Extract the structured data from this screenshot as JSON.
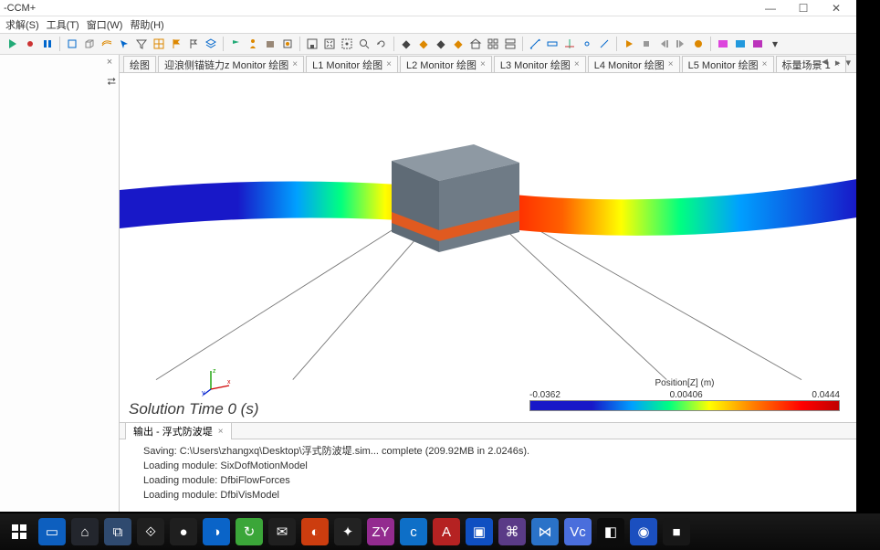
{
  "title_fragment": "-CCM+",
  "window_controls": {
    "min": "—",
    "max": "☐",
    "close": "✕"
  },
  "menu": {
    "solve": "求解(S)",
    "tools": "工具(T)",
    "window": "窗口(W)",
    "help": "帮助(H)"
  },
  "tabs": [
    {
      "label": "绘图"
    },
    {
      "label": "迎浪侧锚链力z Monitor 绘图"
    },
    {
      "label": "L1 Monitor 绘图"
    },
    {
      "label": "L2 Monitor 绘图"
    },
    {
      "label": "L3 Monitor 绘图"
    },
    {
      "label": "L4 Monitor 绘图"
    },
    {
      "label": "L5 Monitor 绘图"
    },
    {
      "label": "标量场景 1"
    }
  ],
  "tab_close_glyph": "×",
  "tab_nav": {
    "prev": "◄",
    "next": "▸",
    "menu": "▾"
  },
  "left_panel": {
    "close_glyph": "×",
    "tree_toggle": "⮂"
  },
  "scene": {
    "solution_time": "Solution Time 0 (s)",
    "triad": {
      "x": "x",
      "y": "y",
      "z": "z"
    },
    "legend": {
      "title": "Position[Z] (m)",
      "min": "-0.0362",
      "mid": "0.00406",
      "max": "0.0444"
    }
  },
  "output": {
    "tab_label": "输出 - 浮式防波堤",
    "lines": [
      "Saving: C:\\Users\\zhangxq\\Desktop\\浮式防波堤.sim... complete (209.92MB in 2.0246s).",
      "Loading module: SixDofMotionModel",
      "Loading module: DfbiFlowForces",
      "Loading module: DfbiVisModel"
    ]
  },
  "taskbar_icons": [
    "⊞",
    "▭",
    "⌂",
    "⧉",
    "⟐",
    "●",
    "◑",
    "↻",
    "✉",
    "◐",
    "✦",
    "ZY",
    "c",
    "A",
    "▣",
    "⌘",
    "⋈",
    "Vc",
    "◧",
    "◉",
    "■",
    "◧"
  ]
}
